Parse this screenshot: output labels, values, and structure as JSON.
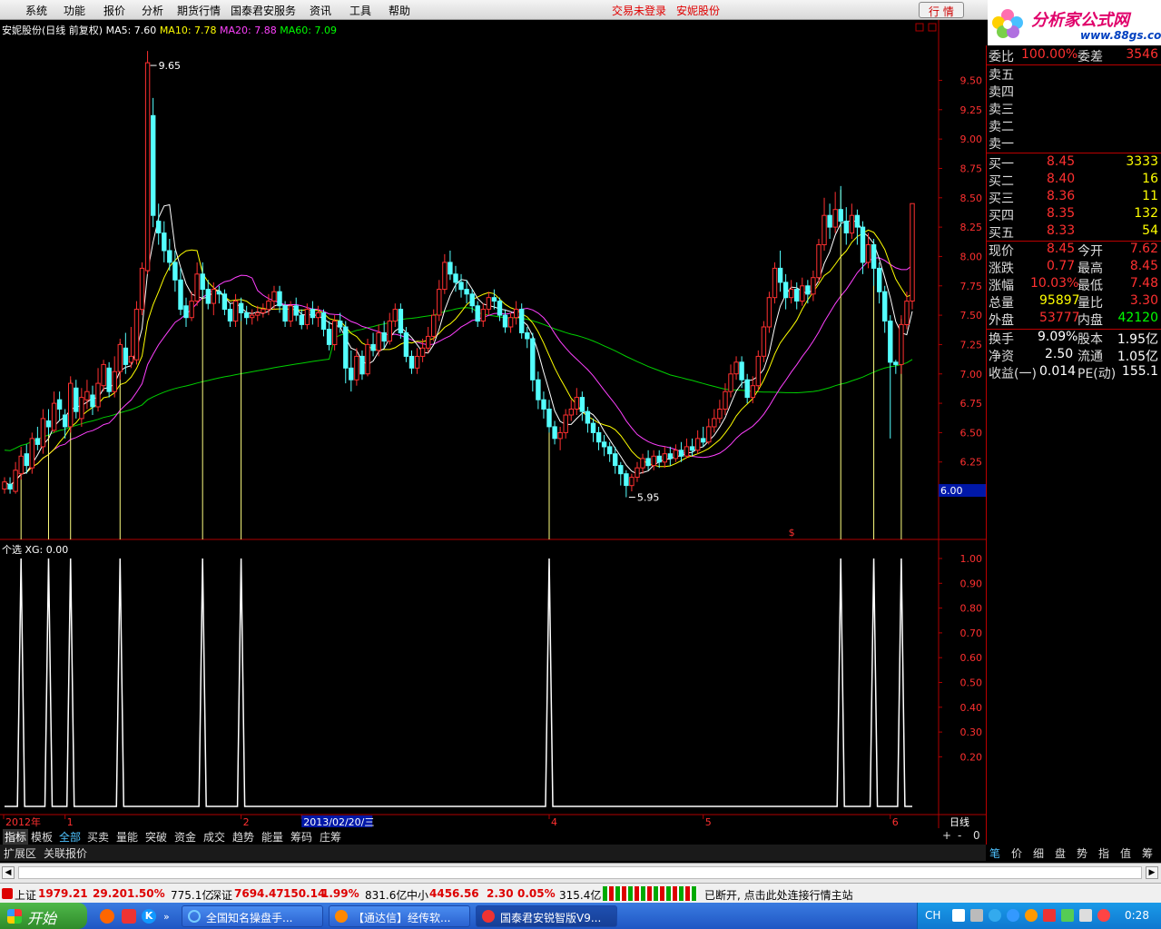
{
  "menu": {
    "items": [
      "系统",
      "功能",
      "报价",
      "分析",
      "期货行情",
      "国泰君安服务",
      "资讯",
      "工具",
      "帮助"
    ],
    "login_status": "交易未登录",
    "stock_name": "安妮股份",
    "quote_button": "行 情"
  },
  "logo": {
    "text": "分析家公式网",
    "url": "www.88gs.com"
  },
  "chart": {
    "title": "安妮股份(日线 前复权)",
    "ma5": "MA5: 7.60",
    "ma10": "MA10: 7.78",
    "ma20": "MA20: 7.88",
    "ma60": "MA60: 7.09",
    "high_label": "9.65",
    "low_label": "5.95",
    "current_price_tag": "6.00",
    "price_ticks": [
      "9.50",
      "9.25",
      "9.00",
      "8.75",
      "8.50",
      "8.25",
      "8.00",
      "7.75",
      "7.50",
      "7.25",
      "7.00",
      "6.75",
      "6.50",
      "6.25",
      "6.00"
    ],
    "indicator_title": "个选  XG: 0.00",
    "indicator_ticks": [
      "1.00",
      "0.90",
      "0.80",
      "0.70",
      "0.60",
      "0.50",
      "0.40",
      "0.30",
      "0.20"
    ],
    "x_labels": [
      {
        "label": "2012年",
        "idx": 0
      },
      {
        "label": "1",
        "idx": 11
      },
      {
        "label": "2",
        "idx": 43
      },
      {
        "label": "2013/02/20/三",
        "idx": 54
      },
      {
        "label": "4",
        "idx": 99
      },
      {
        "label": "5",
        "idx": 127
      },
      {
        "label": "6",
        "idx": 161
      }
    ],
    "period_label": "日线",
    "signal_indices": [
      3,
      8,
      12,
      21,
      36,
      43,
      99,
      152,
      158,
      163
    ],
    "candles": [
      [
        6.02,
        6.08,
        6.12,
        5.98
      ],
      [
        6.06,
        6.02,
        6.12,
        5.98
      ],
      [
        6.0,
        6.18,
        6.25,
        5.98
      ],
      [
        6.15,
        6.3,
        6.38,
        6.1
      ],
      [
        6.32,
        6.22,
        6.4,
        6.15
      ],
      [
        6.2,
        6.45,
        6.5,
        6.15
      ],
      [
        6.45,
        6.4,
        6.55,
        6.35
      ],
      [
        6.38,
        6.62,
        6.7,
        6.32
      ],
      [
        6.6,
        6.55,
        6.7,
        6.48
      ],
      [
        6.52,
        6.75,
        6.85,
        6.5
      ],
      [
        6.78,
        6.7,
        6.85,
        6.6
      ],
      [
        6.65,
        6.55,
        6.7,
        6.45
      ],
      [
        6.55,
        6.92,
        6.98,
        6.5
      ],
      [
        6.88,
        6.68,
        6.95,
        6.62
      ],
      [
        6.62,
        6.8,
        6.88,
        6.55
      ],
      [
        6.78,
        6.85,
        6.95,
        6.7
      ],
      [
        6.82,
        6.72,
        6.9,
        6.65
      ],
      [
        6.72,
        6.92,
        7.05,
        6.68
      ],
      [
        6.9,
        7.08,
        7.12,
        6.85
      ],
      [
        7.05,
        6.85,
        7.1,
        6.8
      ],
      [
        6.85,
        7.02,
        7.15,
        6.8
      ],
      [
        7.02,
        7.25,
        7.3,
        6.95
      ],
      [
        7.22,
        7.08,
        7.35,
        7.0
      ],
      [
        7.1,
        7.15,
        7.4,
        7.05
      ],
      [
        7.12,
        7.55,
        7.62,
        7.08
      ],
      [
        7.55,
        7.9,
        7.95,
        7.5
      ],
      [
        7.88,
        9.65,
        9.75,
        7.85
      ],
      [
        9.2,
        8.35,
        9.35,
        8.25
      ],
      [
        8.3,
        8.2,
        8.45,
        8.1
      ],
      [
        8.2,
        8.05,
        8.3,
        7.95
      ],
      [
        8.05,
        7.95,
        8.15,
        7.88
      ],
      [
        7.95,
        7.8,
        8.05,
        7.7
      ],
      [
        7.8,
        7.55,
        7.9,
        7.5
      ],
      [
        7.58,
        7.48,
        7.65,
        7.4
      ],
      [
        7.48,
        7.62,
        7.7,
        7.45
      ],
      [
        7.62,
        7.85,
        7.95,
        7.58
      ],
      [
        7.85,
        7.72,
        7.95,
        7.65
      ],
      [
        7.72,
        7.6,
        7.8,
        7.55
      ],
      [
        7.6,
        7.72,
        7.78,
        7.5
      ],
      [
        7.7,
        7.68,
        7.75,
        7.6
      ],
      [
        7.68,
        7.55,
        7.72,
        7.5
      ],
      [
        7.55,
        7.45,
        7.6,
        7.4
      ],
      [
        7.45,
        7.62,
        7.68,
        7.4
      ],
      [
        7.6,
        7.52,
        7.65,
        7.45
      ],
      [
        7.52,
        7.48,
        7.58,
        7.42
      ],
      [
        7.48,
        7.5,
        7.55,
        7.42
      ],
      [
        7.5,
        7.52,
        7.58,
        7.45
      ],
      [
        7.52,
        7.55,
        7.6,
        7.48
      ],
      [
        7.55,
        7.62,
        7.68,
        7.5
      ],
      [
        7.62,
        7.7,
        7.75,
        7.55
      ],
      [
        7.7,
        7.58,
        7.75,
        7.52
      ],
      [
        7.58,
        7.45,
        7.62,
        7.4
      ],
      [
        7.45,
        7.58,
        7.62,
        7.4
      ],
      [
        7.58,
        7.5,
        7.65,
        7.45
      ],
      [
        7.5,
        7.42,
        7.55,
        7.38
      ],
      [
        7.42,
        7.55,
        7.6,
        7.38
      ],
      [
        7.55,
        7.48,
        7.62,
        7.42
      ],
      [
        7.48,
        7.52,
        7.58,
        7.4
      ],
      [
        7.52,
        7.38,
        7.55,
        7.32
      ],
      [
        7.38,
        7.25,
        7.45,
        7.2
      ],
      [
        7.25,
        7.45,
        7.5,
        7.2
      ],
      [
        7.45,
        7.4,
        7.52,
        7.35
      ],
      [
        7.4,
        7.05,
        7.45,
        6.92
      ],
      [
        7.05,
        6.95,
        7.2,
        6.85
      ],
      [
        6.95,
        7.15,
        7.22,
        6.9
      ],
      [
        7.15,
        7.0,
        7.2,
        6.95
      ],
      [
        7.0,
        7.25,
        7.3,
        6.98
      ],
      [
        7.25,
        7.2,
        7.35,
        7.15
      ],
      [
        7.2,
        7.35,
        7.42,
        7.15
      ],
      [
        7.35,
        7.28,
        7.45,
        7.22
      ],
      [
        7.28,
        7.45,
        7.52,
        7.25
      ],
      [
        7.45,
        7.55,
        7.6,
        7.4
      ],
      [
        7.55,
        7.35,
        7.6,
        7.3
      ],
      [
        7.35,
        7.15,
        7.4,
        7.1
      ],
      [
        7.15,
        7.05,
        7.2,
        7.0
      ],
      [
        7.05,
        7.15,
        7.22,
        7.0
      ],
      [
        7.15,
        7.22,
        7.3,
        7.1
      ],
      [
        7.22,
        7.32,
        7.4,
        7.18
      ],
      [
        7.32,
        7.5,
        7.55,
        7.28
      ],
      [
        7.5,
        7.72,
        7.8,
        7.45
      ],
      [
        7.72,
        7.95,
        8.02,
        7.68
      ],
      [
        7.95,
        7.85,
        8.05,
        7.8
      ],
      [
        7.85,
        7.78,
        7.92,
        7.7
      ],
      [
        7.78,
        7.72,
        7.85,
        7.65
      ],
      [
        7.72,
        7.68,
        7.8,
        7.6
      ],
      [
        7.68,
        7.58,
        7.72,
        7.52
      ],
      [
        7.58,
        7.45,
        7.62,
        7.4
      ],
      [
        7.45,
        7.55,
        7.6,
        7.4
      ],
      [
        7.55,
        7.65,
        7.7,
        7.5
      ],
      [
        7.65,
        7.62,
        7.72,
        7.55
      ],
      [
        7.62,
        7.5,
        7.65,
        7.45
      ],
      [
        7.5,
        7.4,
        7.55,
        7.35
      ],
      [
        7.4,
        7.48,
        7.52,
        7.35
      ],
      [
        7.48,
        7.55,
        7.62,
        7.42
      ],
      [
        7.55,
        7.35,
        7.6,
        7.3
      ],
      [
        7.35,
        7.3,
        7.4,
        7.22
      ],
      [
        7.3,
        6.95,
        7.35,
        6.85
      ],
      [
        6.95,
        6.78,
        7.02,
        6.7
      ],
      [
        6.78,
        6.7,
        6.85,
        6.62
      ],
      [
        6.7,
        6.55,
        6.78,
        6.5
      ],
      [
        6.55,
        6.45,
        6.6,
        6.4
      ],
      [
        6.45,
        6.5,
        6.55,
        6.35
      ],
      [
        6.5,
        6.65,
        6.7,
        6.45
      ],
      [
        6.65,
        6.7,
        6.78,
        6.6
      ],
      [
        6.7,
        6.8,
        6.88,
        6.65
      ],
      [
        6.8,
        6.68,
        6.85,
        6.6
      ],
      [
        6.68,
        6.58,
        6.72,
        6.5
      ],
      [
        6.58,
        6.5,
        6.62,
        6.42
      ],
      [
        6.5,
        6.42,
        6.55,
        6.35
      ],
      [
        6.42,
        6.38,
        6.48,
        6.3
      ],
      [
        6.38,
        6.32,
        6.42,
        6.25
      ],
      [
        6.32,
        6.22,
        6.38,
        6.15
      ],
      [
        6.22,
        6.15,
        6.25,
        6.05
      ],
      [
        6.15,
        6.05,
        6.18,
        5.95
      ],
      [
        6.05,
        6.12,
        6.15,
        6.0
      ],
      [
        6.12,
        6.2,
        6.25,
        6.08
      ],
      [
        6.2,
        6.28,
        6.32,
        6.15
      ],
      [
        6.28,
        6.22,
        6.35,
        6.18
      ],
      [
        6.22,
        6.3,
        6.35,
        6.18
      ],
      [
        6.3,
        6.25,
        6.35,
        6.2
      ],
      [
        6.25,
        6.32,
        6.38,
        6.2
      ],
      [
        6.32,
        6.28,
        6.38,
        6.22
      ],
      [
        6.28,
        6.35,
        6.4,
        6.25
      ],
      [
        6.35,
        6.3,
        6.42,
        6.25
      ],
      [
        6.3,
        6.38,
        6.45,
        6.28
      ],
      [
        6.38,
        6.35,
        6.45,
        6.3
      ],
      [
        6.35,
        6.45,
        6.52,
        6.32
      ],
      [
        6.45,
        6.42,
        6.55,
        6.38
      ],
      [
        6.42,
        6.55,
        6.62,
        6.4
      ],
      [
        6.55,
        6.62,
        6.7,
        6.5
      ],
      [
        6.62,
        6.7,
        6.78,
        6.58
      ],
      [
        6.7,
        6.85,
        6.92,
        6.65
      ],
      [
        6.85,
        7.0,
        7.08,
        6.8
      ],
      [
        7.0,
        7.1,
        7.15,
        6.95
      ],
      [
        7.1,
        6.95,
        7.15,
        6.88
      ],
      [
        6.95,
        6.8,
        7.0,
        6.75
      ],
      [
        6.8,
        6.9,
        6.98,
        6.75
      ],
      [
        6.9,
        7.15,
        7.2,
        6.85
      ],
      [
        7.15,
        7.4,
        7.45,
        7.1
      ],
      [
        7.4,
        7.65,
        7.7,
        7.35
      ],
      [
        7.65,
        7.9,
        7.95,
        7.6
      ],
      [
        7.9,
        7.78,
        8.05,
        7.7
      ],
      [
        7.78,
        7.65,
        7.85,
        7.55
      ],
      [
        7.65,
        7.72,
        7.8,
        7.6
      ],
      [
        7.72,
        7.62,
        7.78,
        7.55
      ],
      [
        7.62,
        7.75,
        7.82,
        7.58
      ],
      [
        7.75,
        7.68,
        7.8,
        7.6
      ],
      [
        7.68,
        7.82,
        7.88,
        7.62
      ],
      [
        7.82,
        8.1,
        8.15,
        7.78
      ],
      [
        8.1,
        8.35,
        8.5,
        8.05
      ],
      [
        8.35,
        8.25,
        8.45,
        8.15
      ],
      [
        8.25,
        8.4,
        8.55,
        8.2
      ],
      [
        8.4,
        8.3,
        8.6,
        8.25
      ],
      [
        8.3,
        8.2,
        8.42,
        8.1
      ],
      [
        8.2,
        8.35,
        8.45,
        8.15
      ],
      [
        8.35,
        8.25,
        8.4,
        8.1
      ],
      [
        8.25,
        7.95,
        8.3,
        7.85
      ],
      [
        7.95,
        8.1,
        8.2,
        7.9
      ],
      [
        8.1,
        7.9,
        8.15,
        7.75
      ],
      [
        7.9,
        7.7,
        7.95,
        7.6
      ],
      [
        7.7,
        7.45,
        7.75,
        7.35
      ],
      [
        7.45,
        7.1,
        7.5,
        6.45
      ],
      [
        7.1,
        7.08,
        7.12,
        7.0
      ],
      [
        7.08,
        7.42,
        7.5,
        7.0
      ],
      [
        7.42,
        7.62,
        7.7,
        7.38
      ],
      [
        7.62,
        8.45,
        8.45,
        7.55
      ]
    ]
  },
  "quote": {
    "weibi_label": "委比",
    "weibi_value": "100.00%",
    "weicha_label": "委差",
    "weicha_value": "3546",
    "sells": [
      "卖五",
      "卖四",
      "卖三",
      "卖二",
      "卖一"
    ],
    "buys": [
      {
        "label": "买一",
        "price": "8.45",
        "vol": "3333"
      },
      {
        "label": "买二",
        "price": "8.40",
        "vol": "16"
      },
      {
        "label": "买三",
        "price": "8.36",
        "vol": "11"
      },
      {
        "label": "买四",
        "price": "8.35",
        "vol": "132"
      },
      {
        "label": "买五",
        "price": "8.33",
        "vol": "54"
      }
    ],
    "stats": [
      {
        "l1": "现价",
        "v1": "8.45",
        "c1": "#ff3030",
        "l2": "今开",
        "v2": "7.62",
        "c2": "#ff3030"
      },
      {
        "l1": "涨跌",
        "v1": "0.77",
        "c1": "#ff3030",
        "l2": "最高",
        "v2": "8.45",
        "c2": "#ff3030"
      },
      {
        "l1": "涨幅",
        "v1": "10.03%",
        "c1": "#ff3030",
        "l2": "最低",
        "v2": "7.48",
        "c2": "#ff3030"
      },
      {
        "l1": "总量",
        "v1": "95897",
        "c1": "#ffff00",
        "l2": "量比",
        "v2": "3.30",
        "c2": "#ff3030"
      },
      {
        "l1": "外盘",
        "v1": "53777",
        "c1": "#ff3030",
        "l2": "内盘",
        "v2": "42120",
        "c2": "#00ff00"
      },
      {
        "l1": "换手",
        "v1": "9.09%",
        "c1": "#ffffff",
        "l2": "股本",
        "v2": "1.95亿",
        "c2": "#ffffff"
      },
      {
        "l1": "净资",
        "v1": "2.50",
        "c1": "#ffffff",
        "l2": "流通",
        "v2": "1.05亿",
        "c2": "#ffffff"
      },
      {
        "l1": "收益(一)",
        "v1": "0.014",
        "c1": "#ffffff",
        "l2": "PE(动)",
        "v2": "155.1",
        "c2": "#ffffff"
      }
    ]
  },
  "tabs": [
    "指标",
    "模板",
    "全部",
    "买卖",
    "量能",
    "突破",
    "资金",
    "成交",
    "趋势",
    "能量",
    "筹码",
    "庄筹"
  ],
  "tabs2": [
    "扩展区",
    "关联报价"
  ],
  "zoom_buttons": [
    "+",
    "-",
    "0"
  ],
  "right_tabs": [
    "笔",
    "价",
    "细",
    "盘",
    "势",
    "指",
    "值",
    "筹"
  ],
  "status": {
    "sh_label": "上证",
    "sh_index": "1979.21",
    "sh_chg": "29.20",
    "sh_pct": "1.50%",
    "sh_amt": "775.1亿",
    "sz_label": "深证",
    "sz_index": "7694.47",
    "sz_chg": "150.14",
    "sz_pct": "1.99%",
    "sz_amt": "831.6亿",
    "zx_label": "中小",
    "zx_index": "4456.56",
    "zx_chg": "2.30",
    "zx_pct": "0.05%",
    "zx_amt": "315.4亿",
    "message": "已断开, 点击此处连接行情主站"
  },
  "taskbar": {
    "start": "开始",
    "tasks": [
      "全国知名操盘手...",
      "【通达信】经传软...",
      "国泰君安锐智版V9..."
    ],
    "lang": "CH",
    "time": "0:28"
  }
}
